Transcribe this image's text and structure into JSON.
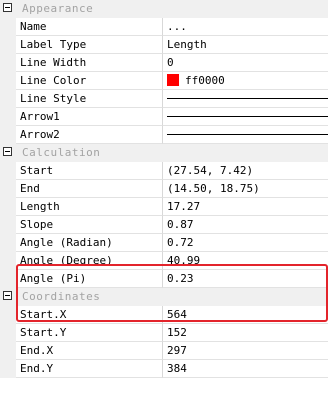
{
  "colors": {
    "line_color_swatch": "#ff0000",
    "highlight_border": "#e3242b"
  },
  "categories": {
    "appearance": "Appearance",
    "calculation": "Calculation",
    "coordinates": "Coordinates"
  },
  "appearance": {
    "name": {
      "label": "Name",
      "value": "..."
    },
    "label_type": {
      "label": "Label Type",
      "value": "Length"
    },
    "line_width": {
      "label": "Line Width",
      "value": "0"
    },
    "line_color": {
      "label": "Line Color",
      "value": "ff0000"
    },
    "line_style": {
      "label": "Line Style"
    },
    "arrow1": {
      "label": "Arrow1"
    },
    "arrow2": {
      "label": "Arrow2"
    }
  },
  "calculation": {
    "start": {
      "label": "Start",
      "value": "(27.54, 7.42)"
    },
    "end": {
      "label": "End",
      "value": "(14.50, 18.75)"
    },
    "length": {
      "label": "Length",
      "value": "17.27"
    },
    "slope": {
      "label": "Slope",
      "value": "0.87"
    },
    "angle_radian": {
      "label": "Angle (Radian)",
      "value": "0.72"
    },
    "angle_degree": {
      "label": "Angle (Degree)",
      "value": "40.99"
    },
    "angle_pi": {
      "label": "Angle (Pi)",
      "value": "0.23"
    }
  },
  "coordinates": {
    "start_x": {
      "label": "Start.X",
      "value": "564"
    },
    "start_y": {
      "label": "Start.Y",
      "value": "152"
    },
    "end_x": {
      "label": "End.X",
      "value": "297"
    },
    "end_y": {
      "label": "End.Y",
      "value": "384"
    }
  }
}
